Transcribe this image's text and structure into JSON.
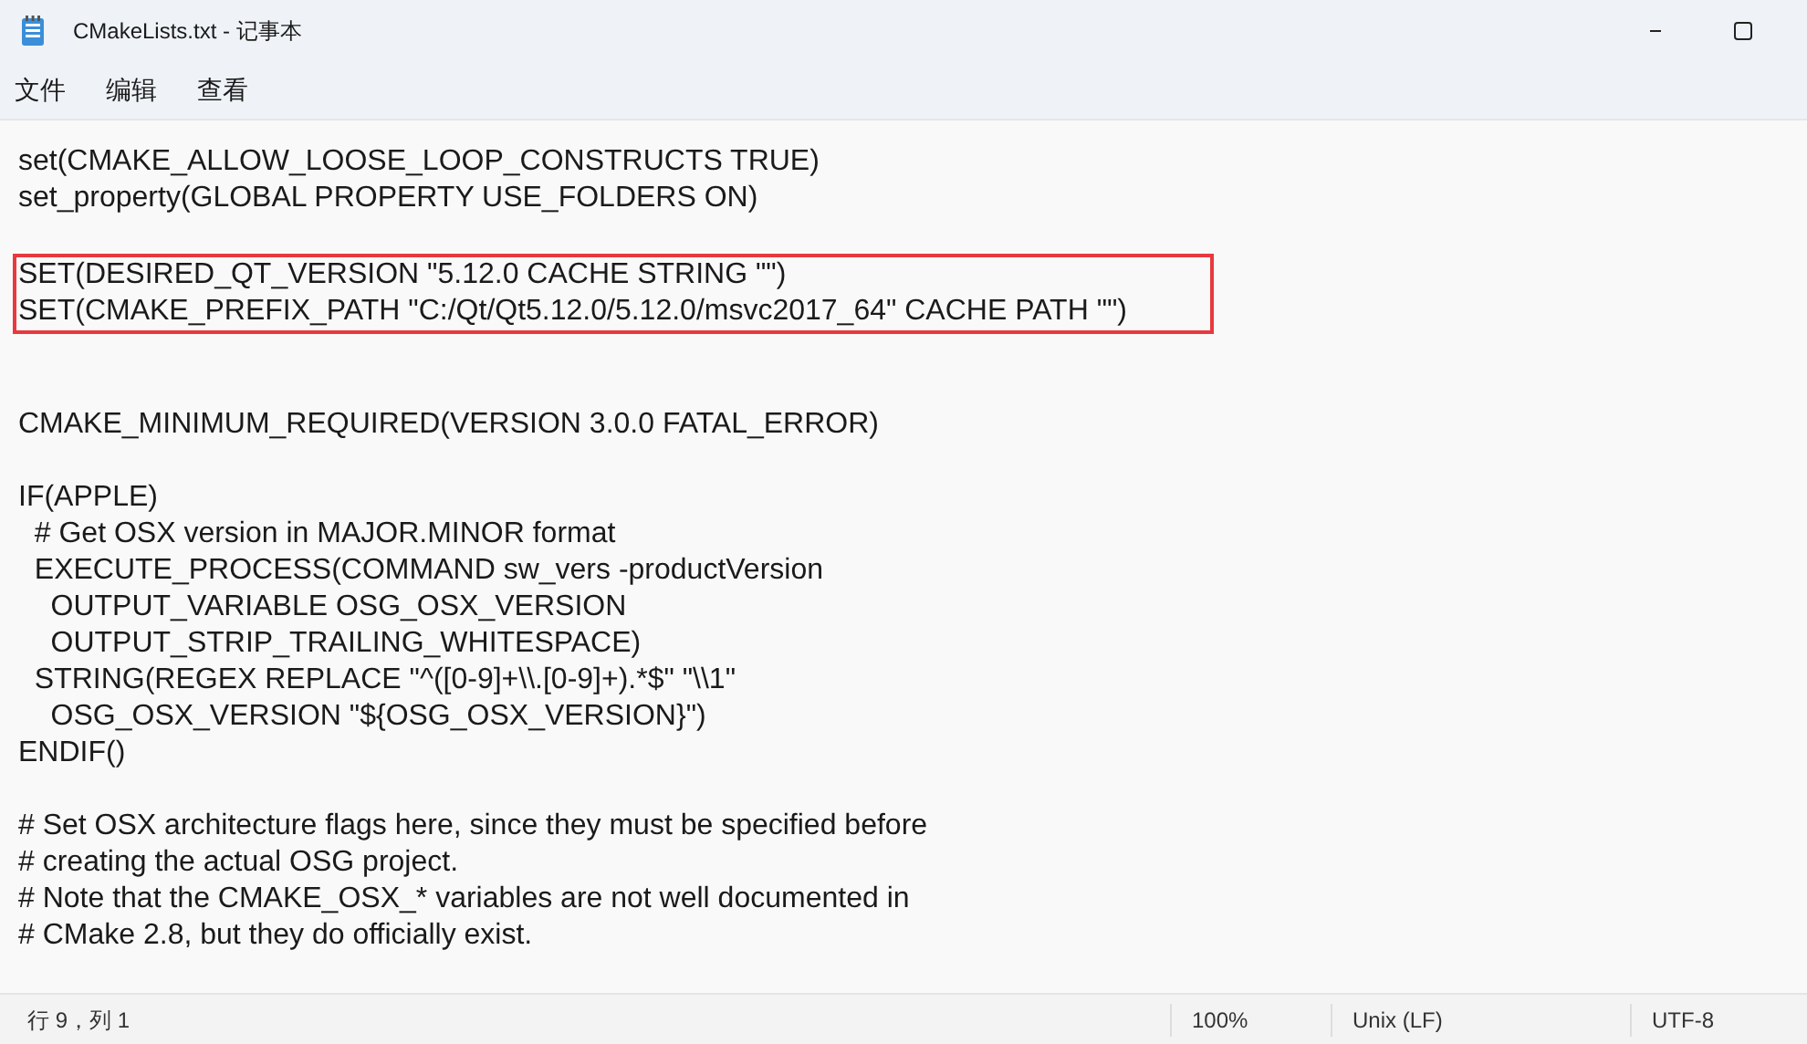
{
  "window": {
    "title": "CMakeLists.txt - 记事本"
  },
  "menu": [
    {
      "label": "文件"
    },
    {
      "label": "编辑"
    },
    {
      "label": "查看"
    }
  ],
  "editor": {
    "blocks": [
      {
        "highlighted": false,
        "lines": [
          {
            "kind": "text",
            "text": "set(CMAKE_ALLOW_LOOSE_LOOP_CONSTRUCTS TRUE)"
          },
          {
            "kind": "text",
            "text": "set_property(GLOBAL PROPERTY USE_FOLDERS ON)"
          },
          {
            "kind": "blank"
          }
        ]
      },
      {
        "highlighted": true,
        "lines": [
          {
            "kind": "text",
            "text": "SET(DESIRED_QT_VERSION \"5.12.0 CACHE STRING \"\")"
          },
          {
            "kind": "text",
            "text": "SET(CMAKE_PREFIX_PATH \"C:/Qt/Qt5.12.0/5.12.0/msvc2017_64\" CACHE PATH \"\")"
          }
        ]
      },
      {
        "highlighted": false,
        "lines": [
          {
            "kind": "blank"
          },
          {
            "kind": "blank"
          },
          {
            "kind": "text",
            "text": "CMAKE_MINIMUM_REQUIRED(VERSION 3.0.0 FATAL_ERROR)"
          },
          {
            "kind": "blank"
          },
          {
            "kind": "text",
            "text": "IF(APPLE)"
          },
          {
            "kind": "text",
            "text": "  # Get OSX version in MAJOR.MINOR format"
          },
          {
            "kind": "text",
            "text": "  EXECUTE_PROCESS(COMMAND sw_vers -productVersion"
          },
          {
            "kind": "text",
            "text": "    OUTPUT_VARIABLE OSG_OSX_VERSION"
          },
          {
            "kind": "text",
            "text": "    OUTPUT_STRIP_TRAILING_WHITESPACE)"
          },
          {
            "kind": "text",
            "text": "  STRING(REGEX REPLACE \"^([0-9]+\\\\.[0-9]+).*$\" \"\\\\1\""
          },
          {
            "kind": "text",
            "text": "    OSG_OSX_VERSION \"${OSG_OSX_VERSION}\")"
          },
          {
            "kind": "text",
            "text": "ENDIF()"
          },
          {
            "kind": "blank"
          },
          {
            "kind": "text",
            "text": "# Set OSX architecture flags here, since they must be specified before"
          },
          {
            "kind": "text",
            "text": "# creating the actual OSG project."
          },
          {
            "kind": "text",
            "text": "# Note that the CMAKE_OSX_* variables are not well documented in"
          },
          {
            "kind": "text",
            "text": "# CMake 2.8, but they do officially exist."
          }
        ]
      }
    ]
  },
  "status_bar": {
    "position": "行 9，列 1",
    "zoom": "100%",
    "line_ending": "Unix (LF)",
    "encoding": "UTF-8"
  }
}
